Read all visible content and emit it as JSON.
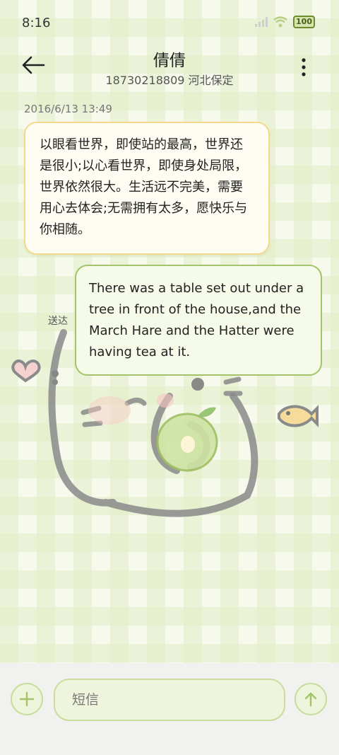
{
  "status_bar": {
    "time": "8:16",
    "battery": "100"
  },
  "header": {
    "contact_name": "倩倩",
    "contact_detail": "18730218809 河北保定"
  },
  "messages": [
    {
      "direction": "incoming",
      "timestamp": "2016/6/13 13:49",
      "text": "以眼看世界，即使站的最高，世界还是很小;以心看世界，即使身处局限，世界依然很大。生活远不完美，需要用心去体会;无需拥有太多，愿快乐与你相随。"
    },
    {
      "direction": "outgoing",
      "status": "送达",
      "text": "There was a table set out under a tree in front of the house,and the March Hare and the Hatter were having tea at it."
    }
  ],
  "composer": {
    "placeholder": "短信"
  },
  "colors": {
    "accent": "#a3c46a",
    "incoming_border": "#f5d98a",
    "background": "#f6f9ec"
  },
  "icons": [
    "back-arrow-icon",
    "more-vert-icon",
    "plus-icon",
    "send-arrow-icon",
    "wifi-icon",
    "signal-icon",
    "battery-icon"
  ]
}
